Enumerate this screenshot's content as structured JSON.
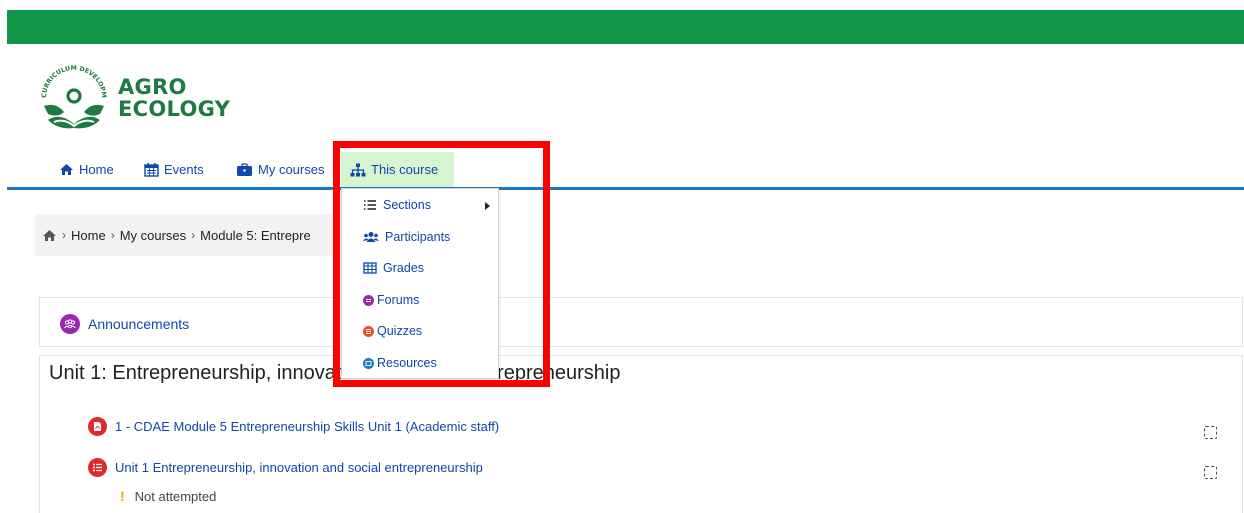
{
  "brand": {
    "line1": "AGRO",
    "line2": "ECOLOGY",
    "ring_text": "CURRICULUM DEVELOPMENT",
    "green": "#12964a",
    "dark_green": "#1f7a41"
  },
  "nav": {
    "items": [
      {
        "label": "Home",
        "icon": "home-icon"
      },
      {
        "label": "Events",
        "icon": "calendar-icon"
      },
      {
        "label": "My courses",
        "icon": "briefcase-icon"
      },
      {
        "label": "This course",
        "icon": "sitemap-icon"
      }
    ],
    "accent": "#1f77c4",
    "link_color": "#0f47ad",
    "active_bg": "#d8f5d2"
  },
  "breadcrumb": {
    "items": [
      "Home",
      "My courses",
      "Module 5: Entrepre"
    ]
  },
  "dropdown": {
    "items": [
      {
        "label": "Sections",
        "icon": "list-icon",
        "has_submenu": true
      },
      {
        "label": "Participants",
        "icon": "users-icon"
      },
      {
        "label": "Grades",
        "icon": "table-icon"
      },
      {
        "label": "Forums",
        "icon": "forum-icon"
      },
      {
        "label": "Quizzes",
        "icon": "quiz-icon"
      },
      {
        "label": "Resources",
        "icon": "resource-icon"
      }
    ]
  },
  "announcements": {
    "label": "Announcements",
    "icon_color": "#9b27af"
  },
  "section": {
    "title": "Unit 1: Entrepreneurship, innovation and social entrepreneurship",
    "activities": [
      {
        "label": "1 - CDAE Module 5 Entrepreneurship Skills Unit 1 (Academic staff)",
        "icon": "pdf-icon"
      },
      {
        "label": "Unit 1 Entrepreneurship, innovation and social entrepreneurship",
        "icon": "quiz-icon"
      }
    ],
    "status": "Not attempted",
    "status_mark": "!"
  },
  "highlight_color": "#ff0000"
}
